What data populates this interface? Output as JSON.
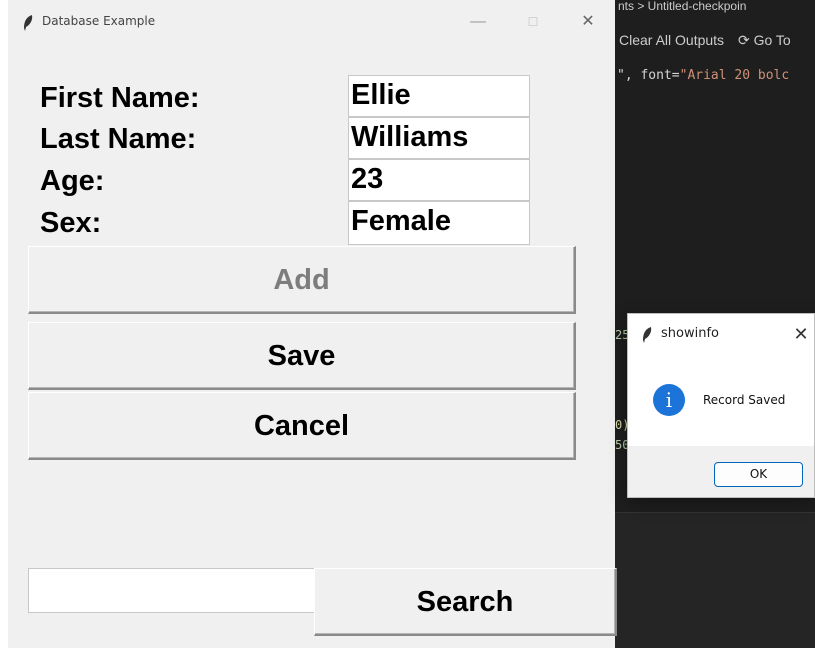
{
  "editor": {
    "breadcrumb": "nts >  Untitled-checkpoin",
    "toolbar_clear": "Clear All Outputs",
    "toolbar_goto": "Go To",
    "code_prefix": "\", font=",
    "code_string": "\"Arial 20 bolc",
    "frag1": "25",
    "frag2": "0)",
    "frag3": "50"
  },
  "main_window": {
    "title": "Database Example",
    "controls": {
      "minimize": "—",
      "maximize": "☐",
      "close": "✕"
    },
    "labels": {
      "first_name": "First Name:",
      "last_name": "Last Name:",
      "age": "Age:",
      "sex": "Sex:"
    },
    "fields": {
      "first_name": "Ellie",
      "last_name": "Williams",
      "age": "23",
      "sex": "Female"
    },
    "buttons": {
      "add": "Add",
      "save": "Save",
      "cancel": "Cancel",
      "search": "Search"
    },
    "search_value": ""
  },
  "dialog": {
    "title": "showinfo",
    "close": "✕",
    "icon": "i",
    "message": "Record Saved",
    "ok": "OK"
  }
}
